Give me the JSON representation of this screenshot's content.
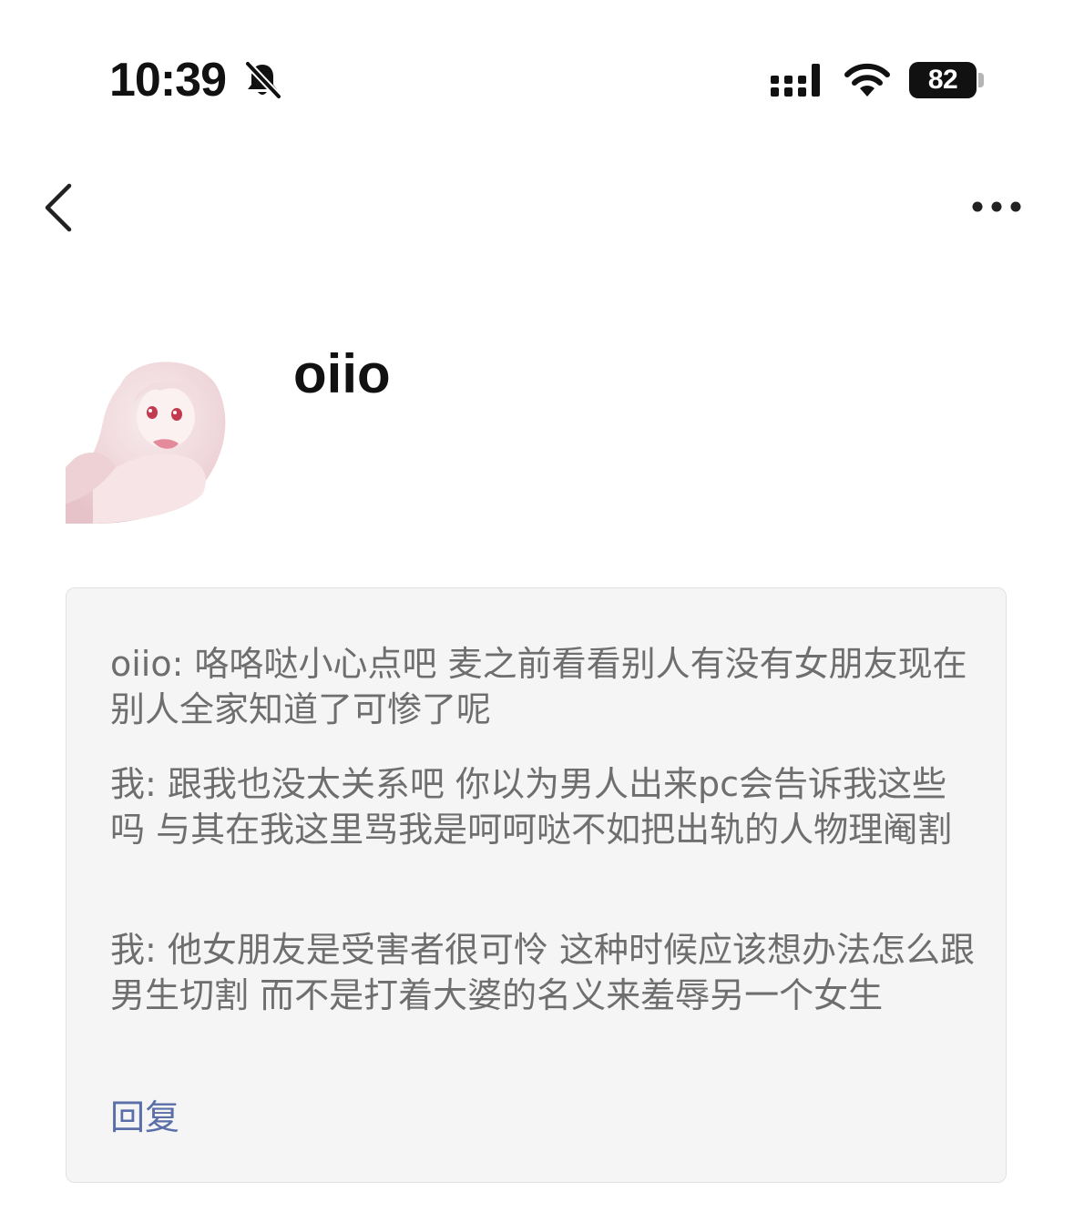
{
  "status_bar": {
    "time": "10:39",
    "battery": "82",
    "icons": [
      "bell-slash-icon",
      "signal-icon",
      "wifi-icon",
      "battery-icon"
    ]
  },
  "nav": {
    "back_icon": "chevron-left-icon",
    "more_icon": "ellipsis-icon"
  },
  "profile": {
    "username": "oiio",
    "avatar": "avatar-image"
  },
  "messages": [
    {
      "text": "oiio: 咯咯哒小心点吧 麦之前看看别人有没有女朋友现在别人全家知道了可惨了呢"
    },
    {
      "text": "我: 跟我也没太关系吧 你以为男人出来pc会告诉我这些吗 与其在我这里骂我是呵呵哒不如把出轨的人物理阉割"
    },
    {
      "text": "我: 他女朋友是受害者很可怜 这种时候应该想办法怎么跟男生切割 而不是打着大婆的名义来羞辱另一个女生"
    }
  ],
  "reply_label": "回复",
  "colors": {
    "card_background": "#f5f5f5",
    "message_text": "#6e6e6e",
    "reply_link": "#5a6ea8"
  }
}
